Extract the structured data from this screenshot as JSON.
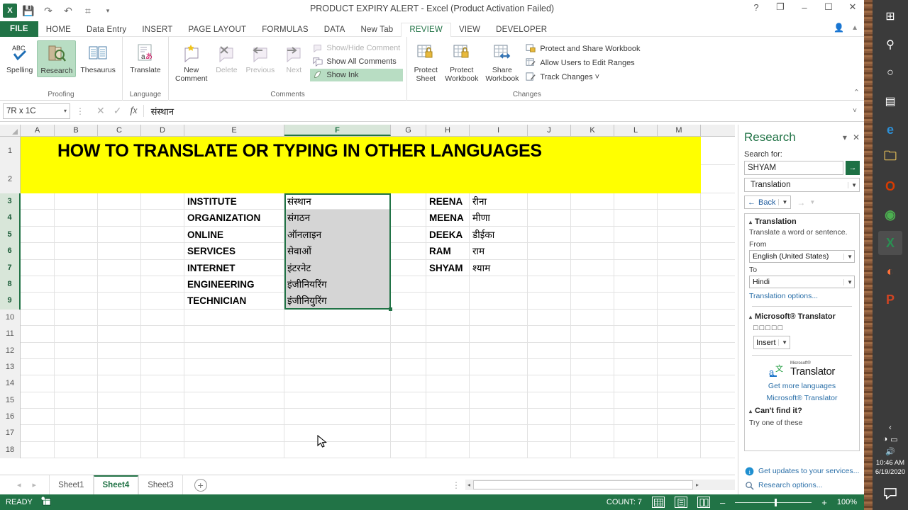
{
  "window": {
    "title": "PRODUCT EXPIRY ALERT - Excel (Product Activation Failed)",
    "help": "?",
    "ribbon_display": "❐",
    "minimize": "–",
    "maximize": "☐",
    "close": "✕"
  },
  "quick_access": {
    "logo": "X",
    "save": "💾",
    "redo": "↷",
    "undo": "↶",
    "touch": "⌗",
    "more": "▾"
  },
  "tabs": [
    {
      "label": "FILE",
      "active": false,
      "file": true
    },
    {
      "label": "HOME",
      "active": false
    },
    {
      "label": "Data Entry",
      "active": false
    },
    {
      "label": "INSERT",
      "active": false
    },
    {
      "label": "PAGE LAYOUT",
      "active": false
    },
    {
      "label": "FORMULAS",
      "active": false
    },
    {
      "label": "DATA",
      "active": false
    },
    {
      "label": "New Tab",
      "active": false
    },
    {
      "label": "REVIEW",
      "active": true
    },
    {
      "label": "VIEW",
      "active": false
    },
    {
      "label": "DEVELOPER",
      "active": false
    }
  ],
  "ribbon": {
    "groups": [
      {
        "name": "Proofing",
        "buttons": [
          {
            "label": "Spelling",
            "icon": "spelling-icon",
            "state": "normal"
          },
          {
            "label": "Research",
            "icon": "research-icon",
            "state": "selected"
          },
          {
            "label": "Thesaurus",
            "icon": "thesaurus-icon",
            "state": "normal"
          }
        ]
      },
      {
        "name": "Language",
        "buttons": [
          {
            "label": "Translate",
            "icon": "translate-icon",
            "state": "normal"
          }
        ]
      },
      {
        "name": "Comments",
        "buttons": [
          {
            "label": "New\nComment",
            "icon": "new-comment-icon",
            "state": "normal"
          },
          {
            "label": "Delete",
            "icon": "delete-comment-icon",
            "state": "disabled"
          },
          {
            "label": "Previous",
            "icon": "previous-comment-icon",
            "state": "disabled"
          },
          {
            "label": "Next",
            "icon": "next-comment-icon",
            "state": "disabled"
          }
        ],
        "small_buttons": [
          {
            "label": "Show/Hide Comment",
            "state": "disabled"
          },
          {
            "label": "Show All Comments",
            "state": "normal"
          },
          {
            "label": "Show Ink",
            "state": "selected"
          }
        ]
      },
      {
        "name": "Changes",
        "buttons": [
          {
            "label": "Protect\nSheet",
            "icon": "protect-sheet-icon",
            "state": "normal"
          },
          {
            "label": "Protect\nWorkbook",
            "icon": "protect-workbook-icon",
            "state": "normal"
          },
          {
            "label": "Share\nWorkbook",
            "icon": "share-workbook-icon",
            "state": "normal"
          }
        ],
        "small_buttons": [
          {
            "label": "Protect and Share Workbook",
            "state": "normal"
          },
          {
            "label": "Allow Users to Edit Ranges",
            "state": "normal"
          },
          {
            "label": "Track Changes ˅",
            "state": "normal"
          }
        ]
      }
    ],
    "collapse": "⌃"
  },
  "formula_bar": {
    "name_box": "7R x 1C",
    "name_box_caret": "▾",
    "cancel": "✕",
    "enter": "✓",
    "fx": "fx",
    "value": "संस्थान",
    "expand": "˅"
  },
  "grid": {
    "columns": [
      "A",
      "B",
      "C",
      "D",
      "E",
      "F",
      "G",
      "H",
      "I",
      "J",
      "K",
      "L",
      "M"
    ],
    "selected_column": "F",
    "rows": [
      "1",
      "2",
      "3",
      "4",
      "5",
      "6",
      "7",
      "8",
      "9",
      "10",
      "11",
      "12",
      "13",
      "14",
      "15",
      "16",
      "17",
      "18"
    ],
    "selected_rows": [
      "3",
      "4",
      "5",
      "6",
      "7",
      "8",
      "9"
    ],
    "banner": "HOW TO TRANSLATE OR TYPING IN OTHER LANGUAGES",
    "banner_color": "#ffff00",
    "data": [
      {
        "row": "3",
        "E": "INSTITUTE",
        "F": "संस्थान",
        "H": "REENA",
        "I": "रीना"
      },
      {
        "row": "4",
        "E": "ORGANIZATION",
        "F": "संगठन",
        "H": "MEENA",
        "I": "मीणा"
      },
      {
        "row": "5",
        "E": "ONLINE",
        "F": "ऑनलाइन",
        "H": "DEEKA",
        "I": "डीईका"
      },
      {
        "row": "6",
        "E": "SERVICES",
        "F": "सेवाओं",
        "H": "RAM",
        "I": "राम"
      },
      {
        "row": "7",
        "E": "INTERNET",
        "F": "इंटरनेट",
        "H": "SHYAM",
        "I": "श्याम"
      },
      {
        "row": "8",
        "E": "ENGINEERING",
        "F": "इंजीनियरिंग",
        "H": "",
        "I": ""
      },
      {
        "row": "9",
        "E": "TECHNICIAN",
        "F": "इंजीनियुरिंग",
        "H": "",
        "I": ""
      }
    ]
  },
  "sheet_tabs": {
    "first": "◂",
    "prev": "▸",
    "items": [
      {
        "label": "Sheet1",
        "active": false
      },
      {
        "label": "Sheet4",
        "active": true
      },
      {
        "label": "Sheet3",
        "active": false
      }
    ],
    "add": "+",
    "dots": "⋮",
    "scroll_left": "◂",
    "scroll_right": "▸"
  },
  "status_bar": {
    "mode": "READY",
    "macro_icon": "record-macro-icon",
    "count": "COUNT: 7",
    "view_normal": "normal-view-icon",
    "view_layout": "page-layout-view-icon",
    "view_break": "page-break-view-icon",
    "zoom_out": "–",
    "zoom_in": "+",
    "zoom": "100%"
  },
  "research_pane": {
    "title": "Research",
    "dropdown": "▾",
    "close": "✕",
    "search_label": "Search for:",
    "search_value": "SHYAM",
    "search_placeholder": "Search for:",
    "go": "→",
    "service": "Translation",
    "back": "Back",
    "back_arrow": "←",
    "forward_arrow": "→",
    "section_title": "Translation",
    "description": "Translate a word or sentence.",
    "from_label": "From",
    "from_value": "English (United States)",
    "to_label": "To",
    "to_value": "Hindi",
    "options_link": "Translation options...",
    "translator_section": "Microsoft® Translator",
    "result_boxes": "□□□□□",
    "insert": "Insert",
    "brand_sup": "Microsoft®",
    "brand": "Translator",
    "get_more_languages": "Get more languages",
    "brand_link": "Microsoft® Translator",
    "cant_find": "Can't find it?",
    "try_one": "Try one of these",
    "updates": "Get updates to your services...",
    "research_options": "Research options..."
  },
  "taskbar": {
    "icons": [
      {
        "name": "windows-start-icon",
        "glyph": "⊞"
      },
      {
        "name": "search-icon",
        "glyph": "⚲"
      },
      {
        "name": "cortana-icon",
        "glyph": "○"
      },
      {
        "name": "task-view-icon",
        "glyph": "▤"
      },
      {
        "name": "edge-icon",
        "glyph": "e"
      },
      {
        "name": "file-explorer-icon",
        "glyph": "🗀"
      },
      {
        "name": "office-icon",
        "glyph": "O"
      },
      {
        "name": "chrome-icon",
        "glyph": "◉"
      },
      {
        "name": "excel-taskbar-icon",
        "glyph": "X"
      },
      {
        "name": "firefox-icon",
        "glyph": "◐"
      },
      {
        "name": "powerpoint-icon",
        "glyph": "P"
      }
    ],
    "tray": {
      "expand": "‹",
      "wifi": "◠",
      "battery": "▭",
      "volume": "🔊",
      "time": "10:46 AM",
      "date": "6/19/2020",
      "action_center": "💬"
    }
  }
}
